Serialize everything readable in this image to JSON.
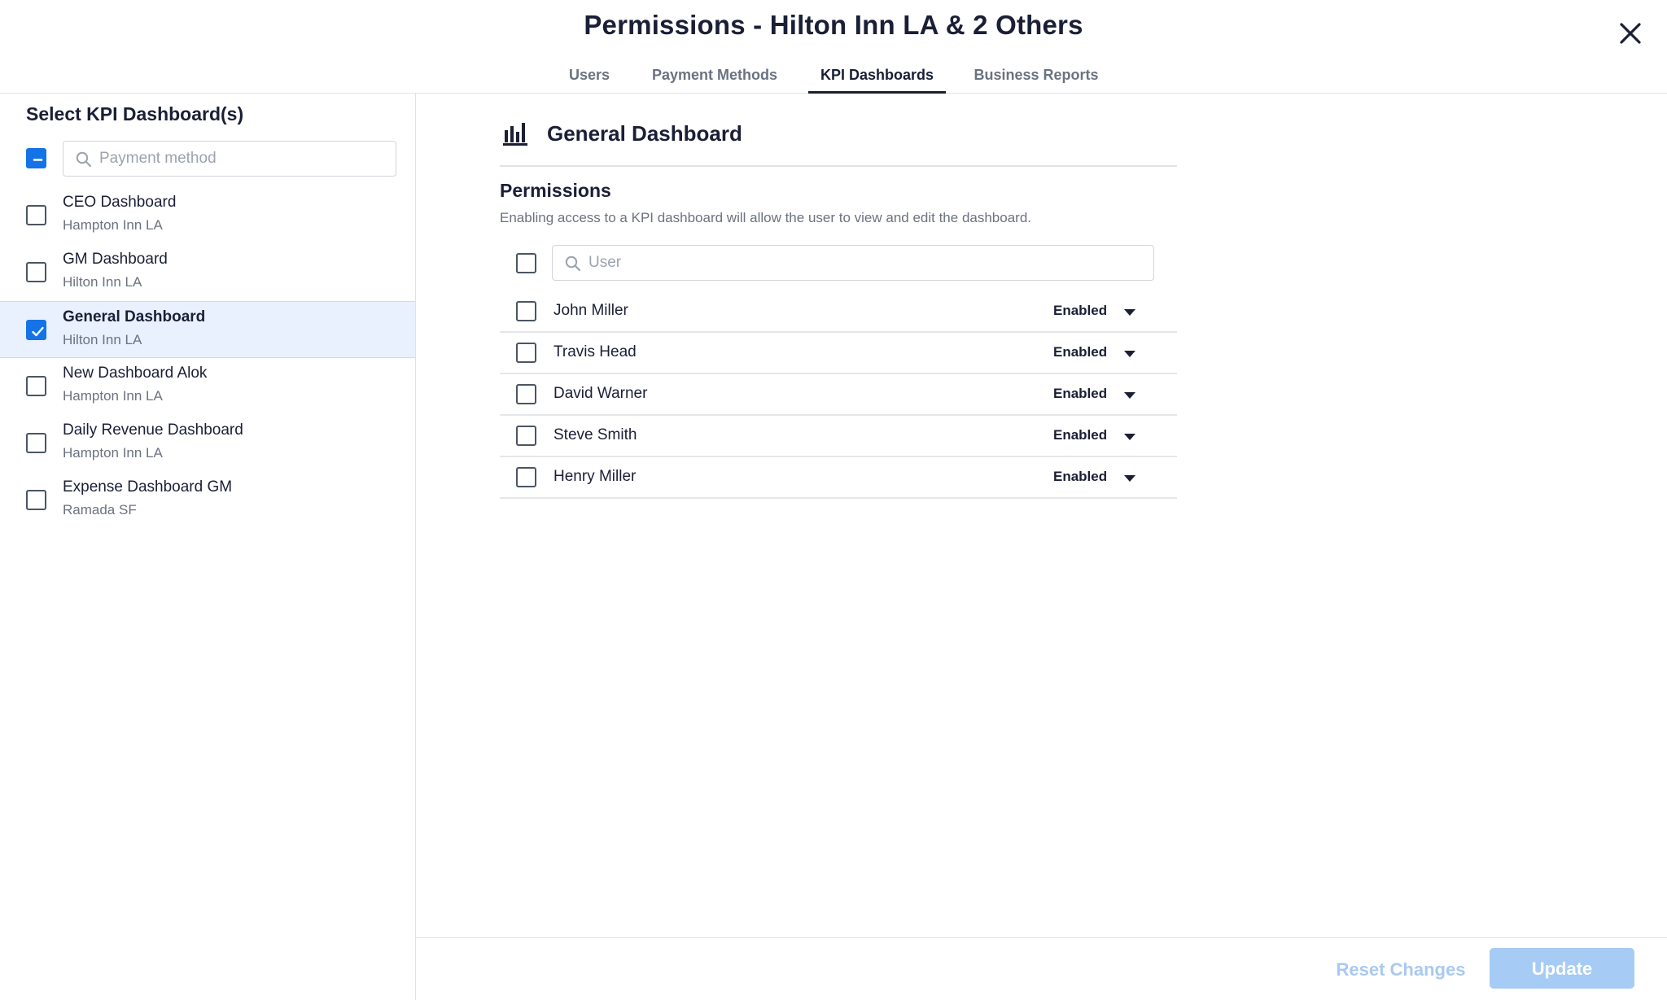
{
  "header": {
    "title": "Permissions - Hilton Inn LA & 2 Others",
    "close_icon": "close-icon"
  },
  "tabs": [
    {
      "label": "Users",
      "active": false
    },
    {
      "label": "Payment Methods",
      "active": false
    },
    {
      "label": "KPI Dashboards",
      "active": true
    },
    {
      "label": "Business Reports",
      "active": false
    }
  ],
  "sidebar": {
    "title": "Select KPI Dashboard(s)",
    "select_all_state": "indeterminate",
    "search_placeholder": "Payment method",
    "items": [
      {
        "name": "CEO Dashboard",
        "property": "Hampton Inn LA",
        "checked": false
      },
      {
        "name": "GM Dashboard",
        "property": "Hilton Inn LA",
        "checked": false
      },
      {
        "name": "General Dashboard",
        "property": "Hilton Inn LA",
        "checked": true
      },
      {
        "name": "New Dashboard Alok",
        "property": "Hampton Inn LA",
        "checked": false
      },
      {
        "name": "Daily Revenue Dashboard",
        "property": "Hampton Inn LA",
        "checked": false
      },
      {
        "name": "Expense Dashboard GM",
        "property": "Ramada SF",
        "checked": false
      }
    ]
  },
  "main": {
    "dashboard_icon": "bar-chart-icon",
    "title": "General Dashboard",
    "permissions_title": "Permissions",
    "permissions_desc": "Enabling access to a KPI dashboard will allow the user to view and edit the dashboard.",
    "user_search_placeholder": "User",
    "users": [
      {
        "name": "John Miller",
        "status": "Enabled"
      },
      {
        "name": "Travis Head",
        "status": "Enabled"
      },
      {
        "name": "David Warner",
        "status": "Enabled"
      },
      {
        "name": "Steve Smith",
        "status": "Enabled"
      },
      {
        "name": "Henry Miller",
        "status": "Enabled"
      }
    ]
  },
  "footer": {
    "reset_label": "Reset Changes",
    "update_label": "Update"
  },
  "colors": {
    "accent": "#1473e6",
    "selected_row": "#e8f1fd",
    "disabled_button": "#a6cbf5",
    "disabled_text": "#a9c9f0"
  }
}
